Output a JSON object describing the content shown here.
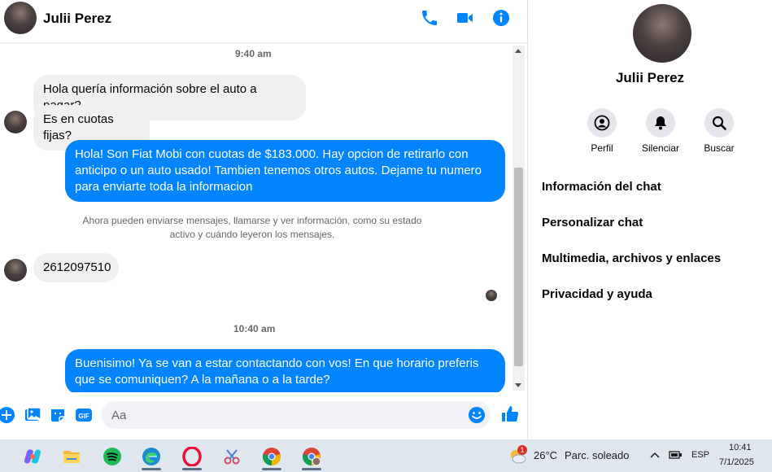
{
  "header": {
    "name": "Julii Perez"
  },
  "messages": {
    "time1": "9:40 am",
    "m1": "Hola quería información sobre el auto a pagar?",
    "m2": "Es en cuotas fijas?",
    "m3": "Hola! Son Fiat Mobi con cuotas de $183.000. Hay opcion de retirarlo con anticipo o un auto usado! Tambien tenemos otros autos. Dejame tu numero para enviarte toda la informacion",
    "system": "Ahora pueden enviarse mensajes, llamarse y ver información, como su estado activo y cuándo leyeron los mensajes.",
    "m4": "2612097510",
    "time2": "10:40 am",
    "m5": "Buenisimo! Ya se van a estar contactando con vos! En que horario preferis que se comuniquen? A la mañana o a la tarde?"
  },
  "composer": {
    "placeholder": "Aa"
  },
  "side": {
    "name": "Julii Perez",
    "actions": [
      "Perfil",
      "Silenciar",
      "Buscar"
    ],
    "menu": [
      "Información del chat",
      "Personalizar chat",
      "Multimedia, archivos y enlaces",
      "Privacidad y ayuda"
    ]
  },
  "taskbar": {
    "weather_temp": "26°C",
    "weather_desc": "Parc. soleado",
    "weather_badge": "1",
    "lang": "ESP",
    "time": "10:41",
    "date": "7/1/2025"
  },
  "colors": {
    "accent": "#0084ff",
    "bubble_in": "#f0f0f0"
  },
  "icons": [
    "phone-icon",
    "video-icon",
    "info-icon",
    "plus-icon",
    "image-icon",
    "sticker-icon",
    "gif-icon",
    "emoji-icon",
    "like-icon",
    "person-icon",
    "bell-icon",
    "search-icon"
  ]
}
